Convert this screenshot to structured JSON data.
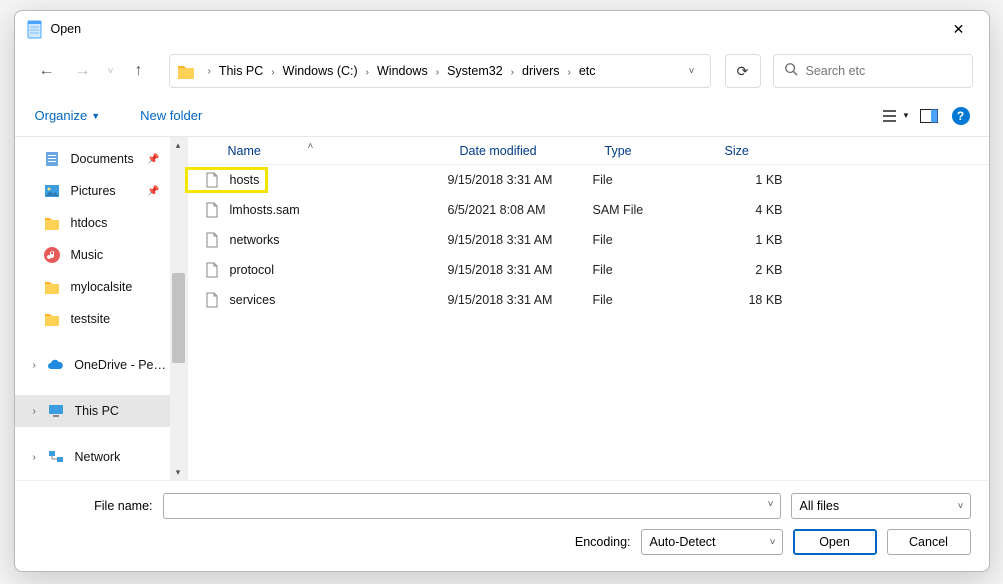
{
  "title": "Open",
  "breadcrumbs": [
    "This PC",
    "Windows (C:)",
    "Windows",
    "System32",
    "drivers",
    "etc"
  ],
  "search_placeholder": "Search etc",
  "toolbar": {
    "organize": "Organize",
    "new_folder": "New folder"
  },
  "sidebar": {
    "items": [
      {
        "label": "Documents",
        "icon": "doc",
        "pinned": true
      },
      {
        "label": "Pictures",
        "icon": "pic",
        "pinned": true
      },
      {
        "label": "htdocs",
        "icon": "folder"
      },
      {
        "label": "Music",
        "icon": "music"
      },
      {
        "label": "mylocalsite",
        "icon": "folder"
      },
      {
        "label": "testsite",
        "icon": "folder"
      }
    ],
    "onedrive": "OneDrive - Perso",
    "thispc": "This PC",
    "network": "Network"
  },
  "columns": {
    "name": "Name",
    "date": "Date modified",
    "type": "Type",
    "size": "Size"
  },
  "files": [
    {
      "name": "hosts",
      "date": "9/15/2018 3:31 AM",
      "type": "File",
      "size": "1 KB",
      "highlight": true
    },
    {
      "name": "lmhosts.sam",
      "date": "6/5/2021 8:08 AM",
      "type": "SAM File",
      "size": "4 KB"
    },
    {
      "name": "networks",
      "date": "9/15/2018 3:31 AM",
      "type": "File",
      "size": "1 KB"
    },
    {
      "name": "protocol",
      "date": "9/15/2018 3:31 AM",
      "type": "File",
      "size": "2 KB"
    },
    {
      "name": "services",
      "date": "9/15/2018 3:31 AM",
      "type": "File",
      "size": "18 KB"
    }
  ],
  "filename_label": "File name:",
  "filename_value": "",
  "filter": "All files",
  "encoding_label": "Encoding:",
  "encoding_value": "Auto-Detect",
  "buttons": {
    "open": "Open",
    "cancel": "Cancel"
  }
}
